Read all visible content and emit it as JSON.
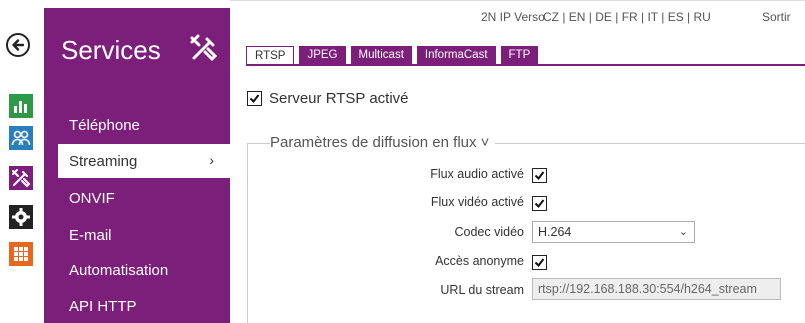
{
  "header": {
    "device_name": "2N IP Verso",
    "languages": "CZ | EN | DE | FR | IT | ES | RU",
    "logout_label": "Sortir"
  },
  "rail": {
    "icons": [
      "back-arrow-icon",
      "bar-chart-icon",
      "users-icon",
      "tools-icon",
      "gear-icon",
      "grid-icon"
    ],
    "colors": {
      "green": "#2e9a48",
      "blue": "#2a7fbf",
      "purple": "#7b1f7a",
      "dark": "#222222",
      "orange": "#e8671f"
    }
  },
  "sidebar": {
    "title": "Services",
    "items": [
      {
        "label": "Téléphone",
        "active": false
      },
      {
        "label": "Streaming",
        "active": true,
        "chevron": "›"
      },
      {
        "label": "ONVIF",
        "active": false
      },
      {
        "label": "E-mail",
        "active": false
      },
      {
        "label": "Automatisation",
        "active": false
      },
      {
        "label": "API HTTP",
        "active": false
      }
    ],
    "accent_color": "#7b1f7a"
  },
  "tabs": [
    {
      "label": "RTSP",
      "active": true
    },
    {
      "label": "JPEG",
      "active": false
    },
    {
      "label": "Multicast",
      "active": false
    },
    {
      "label": "InformaCast",
      "active": false
    },
    {
      "label": "FTP",
      "active": false
    }
  ],
  "rtsp_enabled": {
    "label": "Serveur RTSP activé",
    "checked": true
  },
  "stream_section": {
    "title": "Paramètres de diffusion en flux ˅",
    "audio_label": "Flux audio activé",
    "audio_checked": true,
    "video_label": "Flux vidéo activé",
    "video_checked": true,
    "codec_label": "Codec vidéo",
    "codec_value": "H.264",
    "codec_arrow": "⌄",
    "anon_label": "Accès anonyme",
    "anon_checked": true,
    "url_label": "URL du stream",
    "url_value": "rtsp://192.168.188.30:554/h264_stream"
  }
}
